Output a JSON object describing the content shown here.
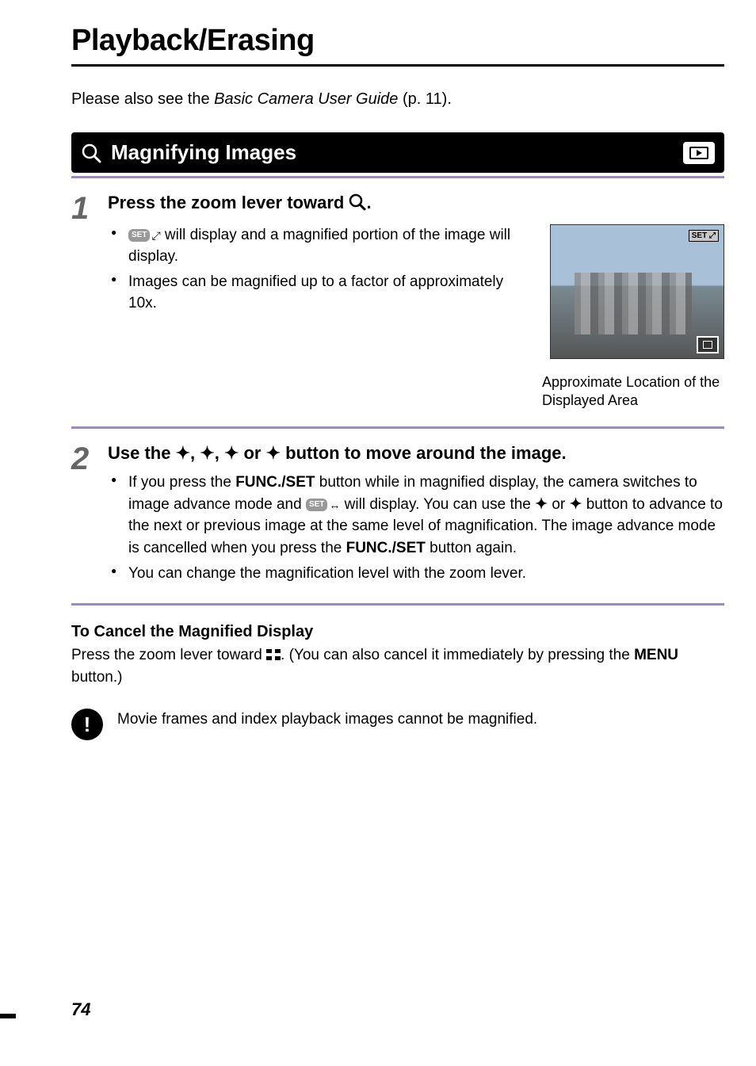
{
  "chapter": {
    "title": "Playback/Erasing"
  },
  "intro": {
    "prefix": "Please also see the ",
    "italic": "Basic Camera User Guide",
    "suffix": " (p. 11)."
  },
  "section": {
    "title": "Magnifying Images"
  },
  "step1": {
    "number": "1",
    "heading_prefix": "Press the zoom lever toward ",
    "heading_suffix": ".",
    "bullet1_prefix": " will display and a magnified portion of the image will display.",
    "bullet2": "Images can be magnified up to a factor of approximately 10x.",
    "caption": "Approximate Location of the Displayed Area",
    "set_label": "SET",
    "overlay_label": "SET"
  },
  "step2": {
    "number": "2",
    "heading_prefix": "Use the ",
    "heading_mid": " or ",
    "heading_suffix": " button to move around the image.",
    "bullet1_a": "If you press the ",
    "bullet1_bold1": "FUNC./SET",
    "bullet1_b": " button while in magnified display, the camera switches to image advance mode and ",
    "bullet1_c": " will display. You can use the ",
    "bullet1_d": " or ",
    "bullet1_e": " button to advance to the next or previous image at the same level of magnification. The image advance mode is cancelled when you press the ",
    "bullet1_bold2": "FUNC./SET",
    "bullet1_f": " button again.",
    "bullet2": "You can change the magnification level with the zoom lever.",
    "set_label": "SET"
  },
  "cancel": {
    "heading": "To Cancel the Magnified Display",
    "text_a": "Press the zoom lever toward ",
    "text_b": ". (You can also cancel it immediately by pressing the ",
    "bold": "MENU",
    "text_c": " button.)"
  },
  "note": {
    "text": "Movie frames and index playback images cannot be magnified."
  },
  "page_number": "74"
}
